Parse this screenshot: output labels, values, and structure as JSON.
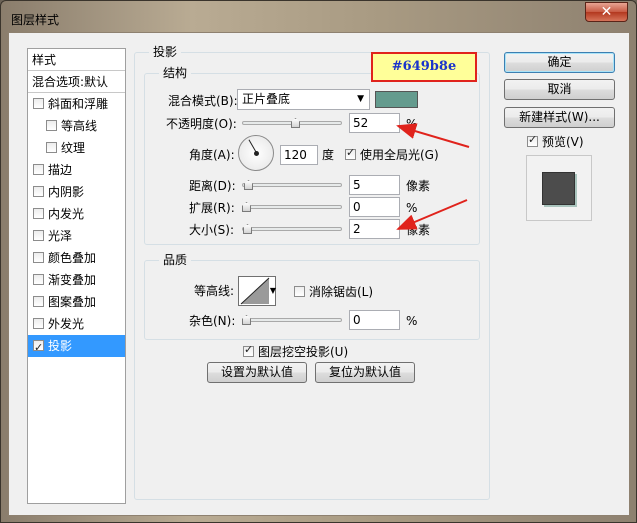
{
  "window": {
    "title": "图层样式",
    "close_label": "✕"
  },
  "styles_list": {
    "header": "样式",
    "blend_options": "混合选项:默认",
    "items": [
      {
        "label": "斜面和浮雕",
        "checked": false,
        "indent": false
      },
      {
        "label": "等高线",
        "checked": false,
        "indent": true
      },
      {
        "label": "纹理",
        "checked": false,
        "indent": true
      },
      {
        "label": "描边",
        "checked": false,
        "indent": false
      },
      {
        "label": "内阴影",
        "checked": false,
        "indent": false
      },
      {
        "label": "内发光",
        "checked": false,
        "indent": false
      },
      {
        "label": "光泽",
        "checked": false,
        "indent": false
      },
      {
        "label": "颜色叠加",
        "checked": false,
        "indent": false
      },
      {
        "label": "渐变叠加",
        "checked": false,
        "indent": false
      },
      {
        "label": "图案叠加",
        "checked": false,
        "indent": false
      },
      {
        "label": "外发光",
        "checked": false,
        "indent": false
      },
      {
        "label": "投影",
        "checked": true,
        "indent": false,
        "selected": true
      }
    ]
  },
  "drop_shadow": {
    "title": "投影",
    "structure": {
      "title": "结构",
      "blend_mode_label": "混合模式(B):",
      "blend_mode_value": "正片叠底",
      "shadow_color": "#649b8e",
      "opacity_label": "不透明度(O):",
      "opacity_value": "52",
      "opacity_unit": "%",
      "angle_label": "角度(A):",
      "angle_value": "120",
      "angle_unit": "度",
      "global_light_label": "使用全局光(G)",
      "global_light_checked": true,
      "distance_label": "距离(D):",
      "distance_value": "5",
      "distance_unit": "像素",
      "spread_label": "扩展(R):",
      "spread_value": "0",
      "spread_unit": "%",
      "size_label": "大小(S):",
      "size_value": "2",
      "size_unit": "像素"
    },
    "quality": {
      "title": "品质",
      "contour_label": "等高线:",
      "anti_alias_label": "消除锯齿(L)",
      "anti_alias_checked": false,
      "noise_label": "杂色(N):",
      "noise_value": "0",
      "noise_unit": "%"
    },
    "knockout_label": "图层挖空投影(U)",
    "knockout_checked": true,
    "make_default_label": "设置为默认值",
    "reset_default_label": "复位为默认值"
  },
  "buttons": {
    "ok": "确定",
    "cancel": "取消",
    "new_style": "新建样式(W)...",
    "preview_label": "预览(V)",
    "preview_checked": true
  },
  "annotation": {
    "color_hex": "#649b8e",
    "annotation_color": "#e0231c"
  }
}
